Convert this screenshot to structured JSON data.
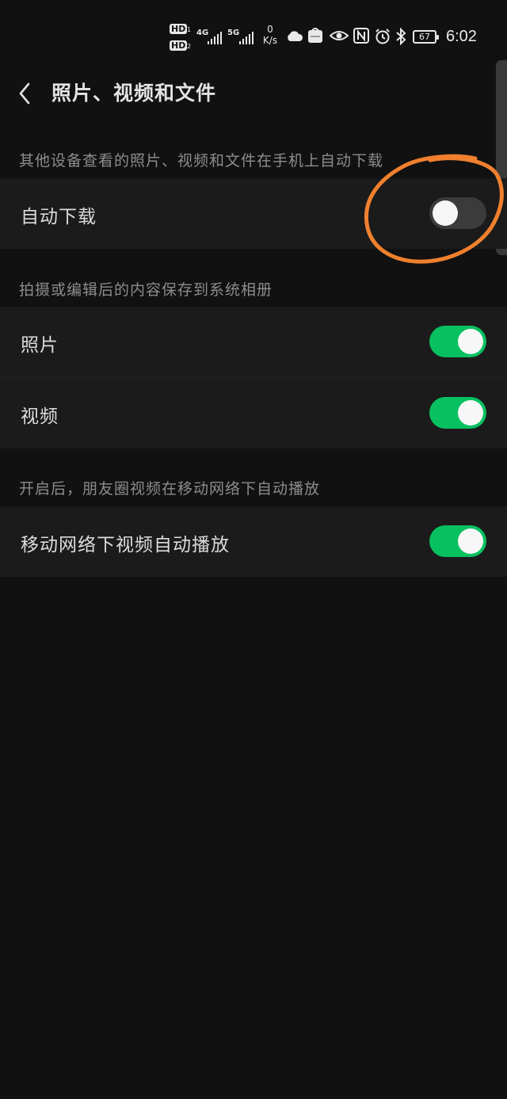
{
  "status_bar": {
    "hd1": "HD",
    "hd1_sub": "1",
    "hd2": "HD",
    "hd2_sub": "2",
    "net1": "4G",
    "net2": "5G",
    "speed_value": "0",
    "speed_unit": "K/s",
    "battery": "67",
    "time": "6:02",
    "icons": [
      "cloud-icon",
      "huawei-app-icon",
      "eye-icon",
      "nfc-icon",
      "alarm-icon",
      "bluetooth-icon"
    ]
  },
  "header": {
    "title": "照片、视频和文件",
    "back_icon": "chevron-left-icon"
  },
  "sections": [
    {
      "caption": "其他设备查看的照片、视频和文件在手机上自动下载",
      "rows": [
        {
          "label": "自动下载",
          "enabled": false
        }
      ]
    },
    {
      "caption": "拍摄或编辑后的内容保存到系统相册",
      "rows": [
        {
          "label": "照片",
          "enabled": true
        },
        {
          "label": "视频",
          "enabled": true
        }
      ]
    },
    {
      "caption": "开启后，朋友圈视频在移动网络下自动播放",
      "rows": [
        {
          "label": "移动网络下视频自动播放",
          "enabled": true
        }
      ]
    }
  ],
  "colors": {
    "background": "#111111",
    "row_background": "#1b1b1b",
    "toggle_on": "#07c160",
    "toggle_off": "#3b3b3b",
    "annotation": "#f0802e"
  }
}
